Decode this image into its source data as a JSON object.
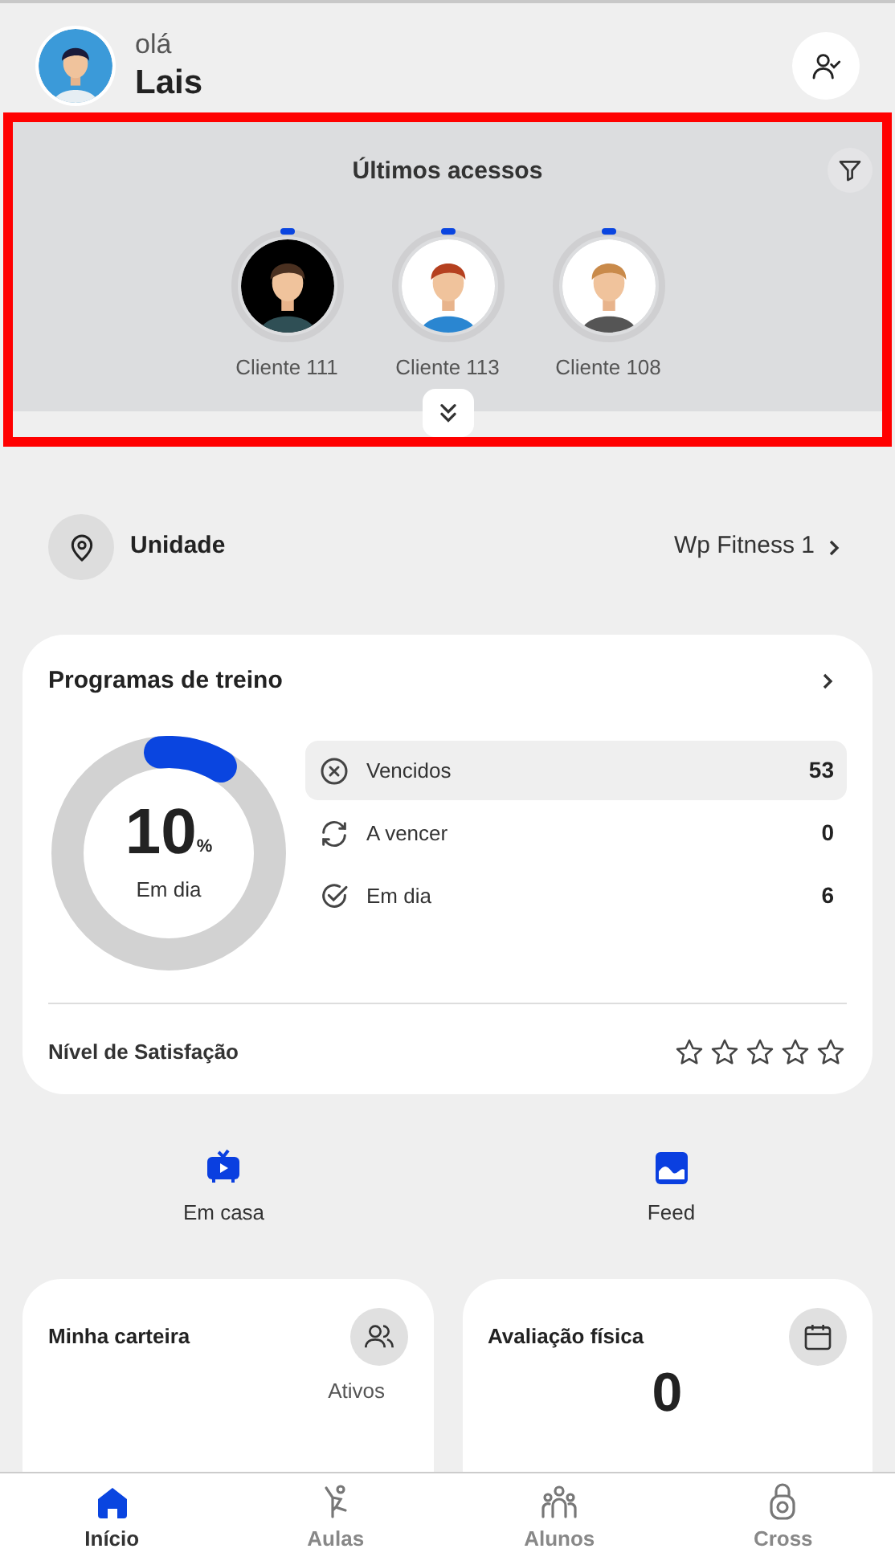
{
  "header": {
    "greeting": "olá",
    "user_name": "Lais"
  },
  "recent_access": {
    "title": "Últimos acessos",
    "clients": [
      {
        "name": "Cliente 111"
      },
      {
        "name": "Cliente 113"
      },
      {
        "name": "Cliente 108"
      }
    ]
  },
  "unit": {
    "label": "Unidade",
    "value": "Wp Fitness 1"
  },
  "training_programs": {
    "title": "Programas de treino",
    "percent": "10",
    "percent_sign": "%",
    "percent_caption": "Em dia",
    "level": 0.1,
    "statuses": [
      {
        "kind": "expired",
        "label": "Vencidos",
        "count": "53",
        "selected": true
      },
      {
        "kind": "renewing",
        "label": "A vencer",
        "count": "0",
        "selected": false
      },
      {
        "kind": "ok",
        "label": "Em dia",
        "count": "6",
        "selected": false
      }
    ],
    "satisfaction": {
      "label": "Nível de Satisfação",
      "stars": 0
    }
  },
  "shortcuts": [
    {
      "kind": "tv",
      "label": "Em casa"
    },
    {
      "kind": "image",
      "label": "Feed"
    }
  ],
  "cards": [
    {
      "kind": "people",
      "title": "Minha carteira",
      "column_label": "Ativos"
    },
    {
      "kind": "calendar",
      "title": "Avaliação física",
      "value": "0"
    }
  ],
  "nav": [
    {
      "kind": "home",
      "label": "Início",
      "selected": true
    },
    {
      "kind": "class",
      "label": "Aulas",
      "selected": false
    },
    {
      "kind": "students",
      "label": "Alunos",
      "selected": false
    },
    {
      "kind": "kettlebell",
      "label": "Cross",
      "selected": false
    }
  ]
}
